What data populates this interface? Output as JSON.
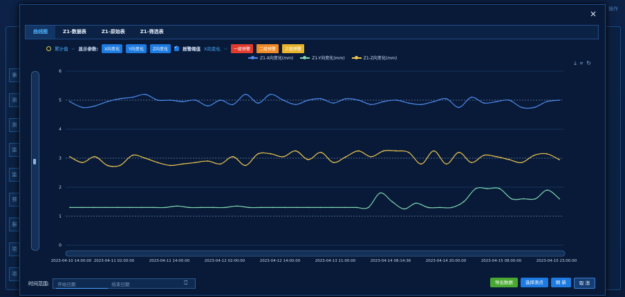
{
  "background": {
    "top_right_text": "操作",
    "left_items": [
      "第",
      "测",
      "测",
      "监",
      "监",
      "预",
      "报",
      "项",
      "项"
    ]
  },
  "modal": {
    "close_glyph": "×"
  },
  "tabs": [
    "曲线图",
    "Z1-数据表",
    "Z1-原始表",
    "Z1-筛选表"
  ],
  "controls": {
    "cumulative_label": "累计值",
    "params_label": "显示参数:",
    "param_x": "X向变化",
    "param_y": "Y向变化",
    "param_z": "Z向变化",
    "alarm_label": "报警阈值",
    "axis_select": "X向变化",
    "warn1": "一级预警",
    "warn2": "二级预警",
    "warn3": "三级预警"
  },
  "toolbar_icons": [
    "download-icon",
    "crop-icon",
    "restore-icon"
  ],
  "colors": {
    "x_series": "#4f8cf0",
    "y_series": "#7fd6b0",
    "z_series": "#f0c850",
    "warn1": "#e23b2e",
    "warn2": "#f08a24",
    "warn3": "#e8b52a",
    "accent": "#1c7ae0"
  },
  "chart_data": {
    "type": "line",
    "ylim": [
      0,
      6
    ],
    "yticks": [
      0,
      1,
      2,
      3,
      4,
      5,
      6
    ],
    "xticks": [
      "2023-04-10 14:00:00",
      "2023-04-11 02:00:00",
      "2023-04-11 14:00:00",
      "2023-04-12 02:00:00",
      "2023-04-12 14:00:00",
      "2023-04-13 11:00:00",
      "2023-04-14 08:14:36",
      "2023-04-14 20:00:00",
      "2023-04-15 08:00:00",
      "2023-04-15 23:00:00"
    ],
    "series": [
      {
        "name": "Z1-X向变化(mm)",
        "values": [
          4.95,
          4.75,
          4.8,
          4.95,
          5.05,
          5.1,
          5.2,
          5.0,
          5.0,
          4.95,
          5.0,
          4.8,
          5.0,
          4.85,
          5.2,
          4.9,
          5.2,
          5.0,
          4.85,
          5.0,
          5.05,
          4.9,
          5.05,
          5.0,
          4.85,
          4.95,
          5.0,
          4.9,
          4.85,
          4.95,
          5.05,
          4.75,
          5.1,
          4.9,
          4.95,
          5.0,
          4.75,
          4.75,
          4.95,
          5.0
        ]
      },
      {
        "name": "Z1-Y向变化(mm)",
        "values": [
          1.3,
          1.3,
          1.3,
          1.3,
          1.3,
          1.3,
          1.3,
          1.3,
          1.3,
          1.35,
          1.3,
          1.3,
          1.3,
          1.3,
          1.35,
          1.3,
          1.3,
          1.3,
          1.3,
          1.3,
          1.3,
          1.3,
          1.3,
          1.3,
          1.3,
          1.3,
          1.8,
          1.5,
          1.25,
          1.45,
          1.3,
          1.3,
          1.3,
          1.5,
          1.95,
          1.95,
          1.95,
          1.6,
          1.6,
          1.6,
          1.9,
          1.6
        ]
      },
      {
        "name": "Z1-Z向变化(mm)",
        "values": [
          3.05,
          2.85,
          3.05,
          2.75,
          2.75,
          3.1,
          3.0,
          2.85,
          2.75,
          2.8,
          2.85,
          2.9,
          2.8,
          3.05,
          2.75,
          3.15,
          3.15,
          3.05,
          3.25,
          2.95,
          3.2,
          2.85,
          3.05,
          3.25,
          3.05,
          3.25,
          3.25,
          3.2,
          2.8,
          3.25,
          2.8,
          3.2,
          2.85,
          3.1,
          3.05,
          2.95,
          2.85,
          3.1,
          3.15,
          2.95
        ]
      }
    ],
    "threshold_lines": [
      5,
      3,
      1
    ]
  },
  "bottom": {
    "range_label": "时间范围:",
    "start_placeholder": "开始日期",
    "end_placeholder": "结束日期",
    "export_label": "导出数据",
    "select_points_label": "选择测点",
    "refresh_label": "刷 新",
    "cancel_label": "取 消"
  }
}
